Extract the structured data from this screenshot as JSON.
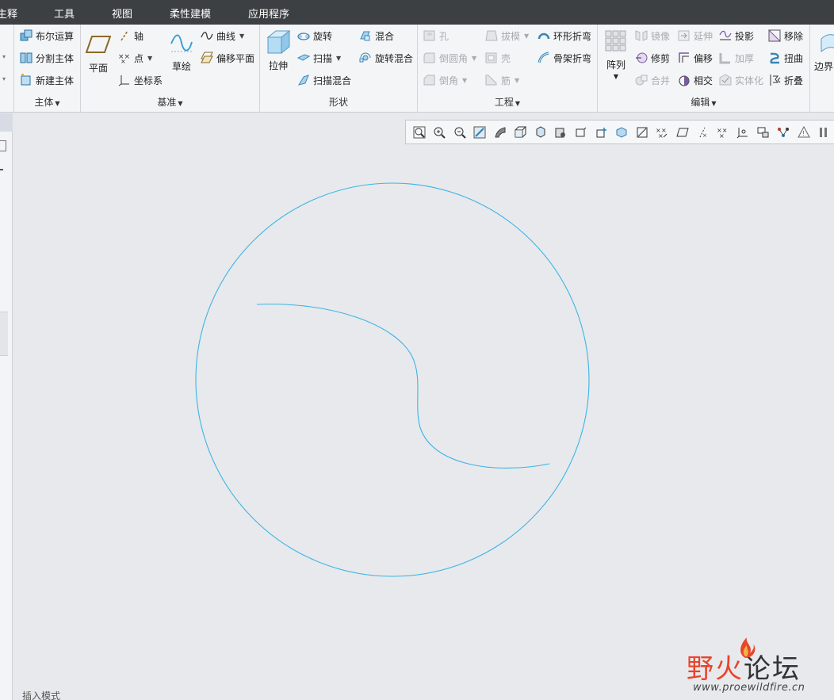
{
  "menubar": {
    "items": [
      "注释",
      "工具",
      "视图",
      "柔性建模",
      "应用程序"
    ],
    "display": [
      "主释",
      "工具",
      "视图",
      "柔性建模",
      "应用程序"
    ]
  },
  "ribbon": {
    "body_group": {
      "label": "主体",
      "commands": [
        "布尔运算",
        "分割主体",
        "新建主体"
      ]
    },
    "datum_group": {
      "label": "基准",
      "plane": "平面",
      "axis": "轴",
      "point": "点",
      "csys": "坐标系",
      "sketch": "草绘",
      "curve": "曲线",
      "offset_plane": "偏移平面"
    },
    "shapes_group": {
      "label": "形状",
      "extrude": "拉伸",
      "revolve": "旋转",
      "sweep": "扫描",
      "swept_blend": "扫描混合",
      "blend": "混合",
      "rotational_blend": "旋转混合"
    },
    "engineering_group": {
      "label": "工程",
      "hole": "孔",
      "round": "倒圆角",
      "chamfer": "倒角",
      "draft": "拔模",
      "shell": "壳",
      "rib": "筋",
      "toroidal_bend": "环形折弯",
      "spinal_bend": "骨架折弯"
    },
    "edit_group": {
      "label": "编辑",
      "pattern": "阵列",
      "mirror": "镜像",
      "trim": "修剪",
      "merge": "合并",
      "extend": "延伸",
      "offset": "偏移",
      "intersect": "相交",
      "project": "投影",
      "thicken": "加厚",
      "solidify": "实体化",
      "remove": "移除",
      "twist": "扭曲",
      "fold": "折叠"
    },
    "boundary": "边界"
  },
  "status": {
    "mode": "插入模式"
  },
  "watermark": {
    "cn_a": "野火",
    "cn_b": "论坛",
    "url": "www.proewildfire.cn"
  },
  "colors": {
    "curve": "#3cb4e6",
    "menubar": "#3c4043",
    "ribbon": "#f4f5f7",
    "canvas": "#e8e9ec"
  },
  "view_toolbar": {
    "icons": [
      "refit-icon",
      "zoom-in-icon",
      "zoom-out-icon",
      "repaint-icon",
      "display-style-icon",
      "saved-views-icon",
      "view-manager-icon",
      "perspective-icon",
      "spin-center-icon",
      "annotation-display-icon",
      "plane-display-icon",
      "axis-display-icon",
      "point-display-icon",
      "csys-display-icon",
      "point-tags-icon",
      "more-datum-icon",
      "selection-filter-icon",
      "snap-icon",
      "warning-icon",
      "pause-icon"
    ]
  }
}
